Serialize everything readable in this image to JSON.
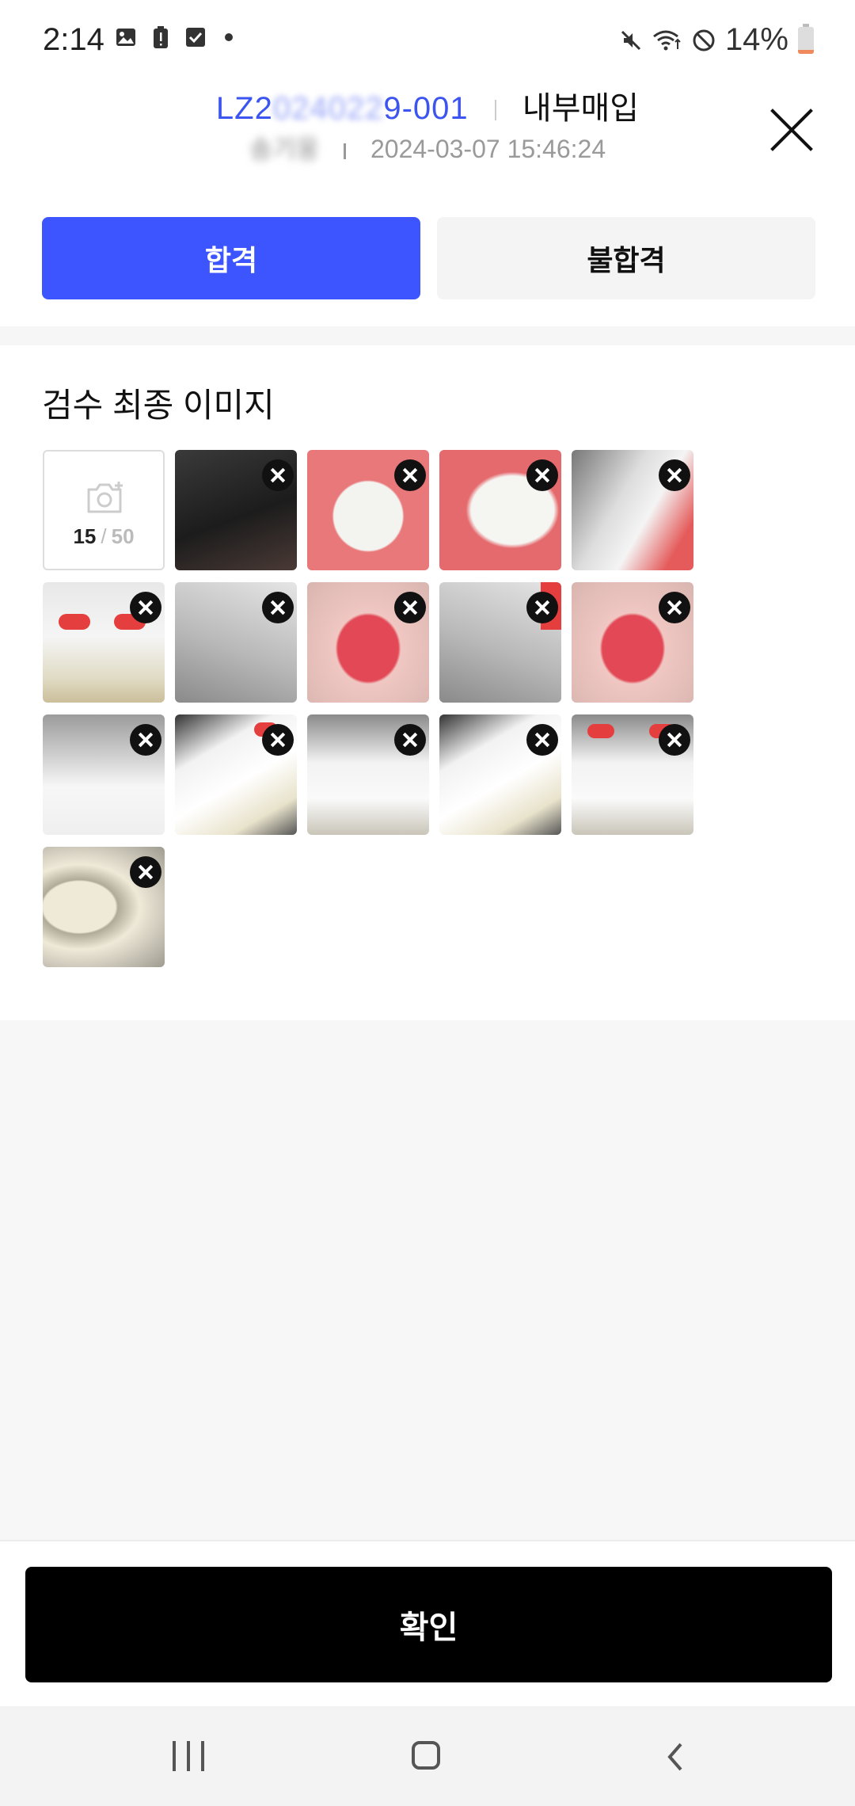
{
  "status_bar": {
    "time": "2:14",
    "battery_percent": "14%",
    "battery_level": 0.14,
    "icons_left": [
      "gallery-icon",
      "battery-alert-icon",
      "checkbox-icon",
      "dot-icon"
    ],
    "icons_right": [
      "mute-icon",
      "wifi-icon",
      "do-not-disturb-icon",
      "battery-icon"
    ]
  },
  "header": {
    "order_id_prefix": "LZ2",
    "order_id_blurred": "024022",
    "order_id_suffix": "9-001",
    "order_type": "내부매입",
    "person_blurred": "송기웅",
    "datetime": "2024-03-07 15:46:24"
  },
  "actions": {
    "pass_label": "합격",
    "fail_label": "불합격",
    "selected": "합격"
  },
  "section": {
    "title": "검수 최종 이미지"
  },
  "image_grid": {
    "current_count": "15",
    "max_count": "50",
    "separator": "/",
    "images": [
      {
        "name": "tag-photo-1",
        "fill": "p-dark"
      },
      {
        "name": "tag-photo-2",
        "fill": "p-pinklabel"
      },
      {
        "name": "tag-photo-3",
        "fill": "p-pinkqr"
      },
      {
        "name": "shoe-photo-4",
        "fill": "p-shoeblack"
      },
      {
        "name": "heel-photo-5",
        "fill": "p-heelred"
      },
      {
        "name": "box-photo-6",
        "fill": "p-box"
      },
      {
        "name": "insole-photo-7",
        "fill": "p-insole"
      },
      {
        "name": "box-photo-8",
        "fill": "p-box"
      },
      {
        "name": "insole-photo-9",
        "fill": "p-insole"
      },
      {
        "name": "box-label-photo-10",
        "fill": "p-boxtag"
      },
      {
        "name": "shoe-photo-11",
        "fill": "p-shoewhite"
      },
      {
        "name": "shoes-photo-12",
        "fill": "p-shoes2"
      },
      {
        "name": "shoe-photo-13",
        "fill": "p-shoewhite"
      },
      {
        "name": "shoes-photo-14",
        "fill": "p-shoes2"
      },
      {
        "name": "sole-photo-15",
        "fill": "p-sole"
      }
    ]
  },
  "footer": {
    "confirm_label": "확인"
  },
  "colors": {
    "accent": "#3d55ff",
    "order_id": "#3d55f0",
    "confirm_bg": "#000000",
    "fail_bg": "#f4f4f4"
  }
}
